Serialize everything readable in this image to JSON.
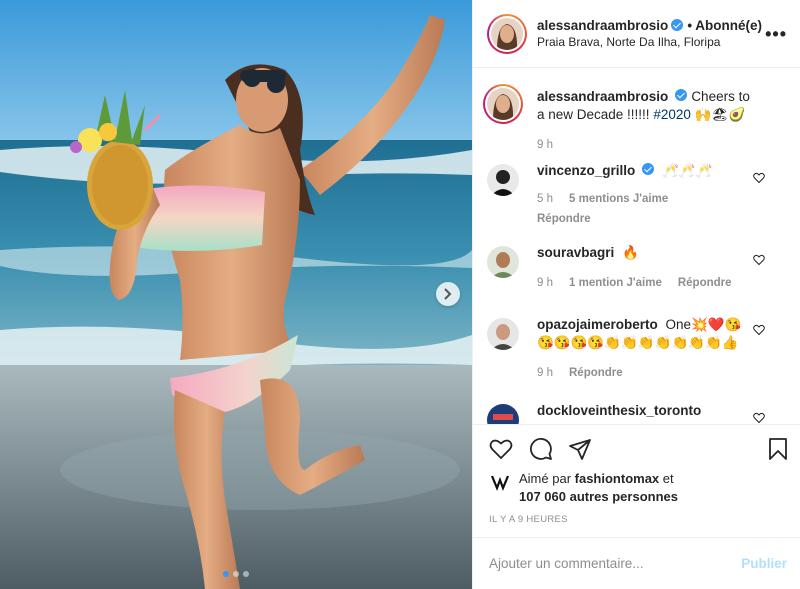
{
  "post": {
    "author": "alessandraambrosio",
    "follow_status": "• Abonné(e)",
    "location": "Praia Brava, Norte Da Ilha, Floripa",
    "more_glyph": "•••",
    "caption_author": "alessandraambrosio",
    "caption_text": "Cheers to a new Decade !!!!!! ",
    "caption_hashtag": "#2020",
    "caption_emoji": "🙌🏖🥑",
    "caption_time": "9 h"
  },
  "comments": [
    {
      "user": "vincenzo_grillo",
      "text": "🥂🥂🥂",
      "time": "5 h",
      "likes": "5 mentions J'aime",
      "reply": "Répondre"
    },
    {
      "user": "souravbagri",
      "text": "🔥",
      "time": "9 h",
      "likes": "1 mention J'aime",
      "reply": "Répondre"
    },
    {
      "user": "opazojaimeroberto",
      "text": "One💥❤️😘 😘😘😘😘👏👏👏👏👏👏👏👍",
      "time": "9 h",
      "reply": "Répondre"
    },
    {
      "user": "dockloveinthesix_toronto"
    }
  ],
  "liked_by": {
    "prefix": "Aimé par ",
    "user": "fashiontomax",
    "suffix": " et",
    "others": "107 060 autres personnes"
  },
  "timestamp": "IL Y A 9 HEURES",
  "add_comment": {
    "placeholder": "Ajouter un commentaire...",
    "publish": "Publier"
  },
  "colors": {
    "accent": "#3897f0",
    "publish_disabled": "#b2dffc",
    "muted": "#8e8e8e"
  },
  "icons": [
    "heart-icon",
    "comment-icon",
    "share-icon",
    "bookmark-icon",
    "chevron-right-icon",
    "verified-icon"
  ]
}
